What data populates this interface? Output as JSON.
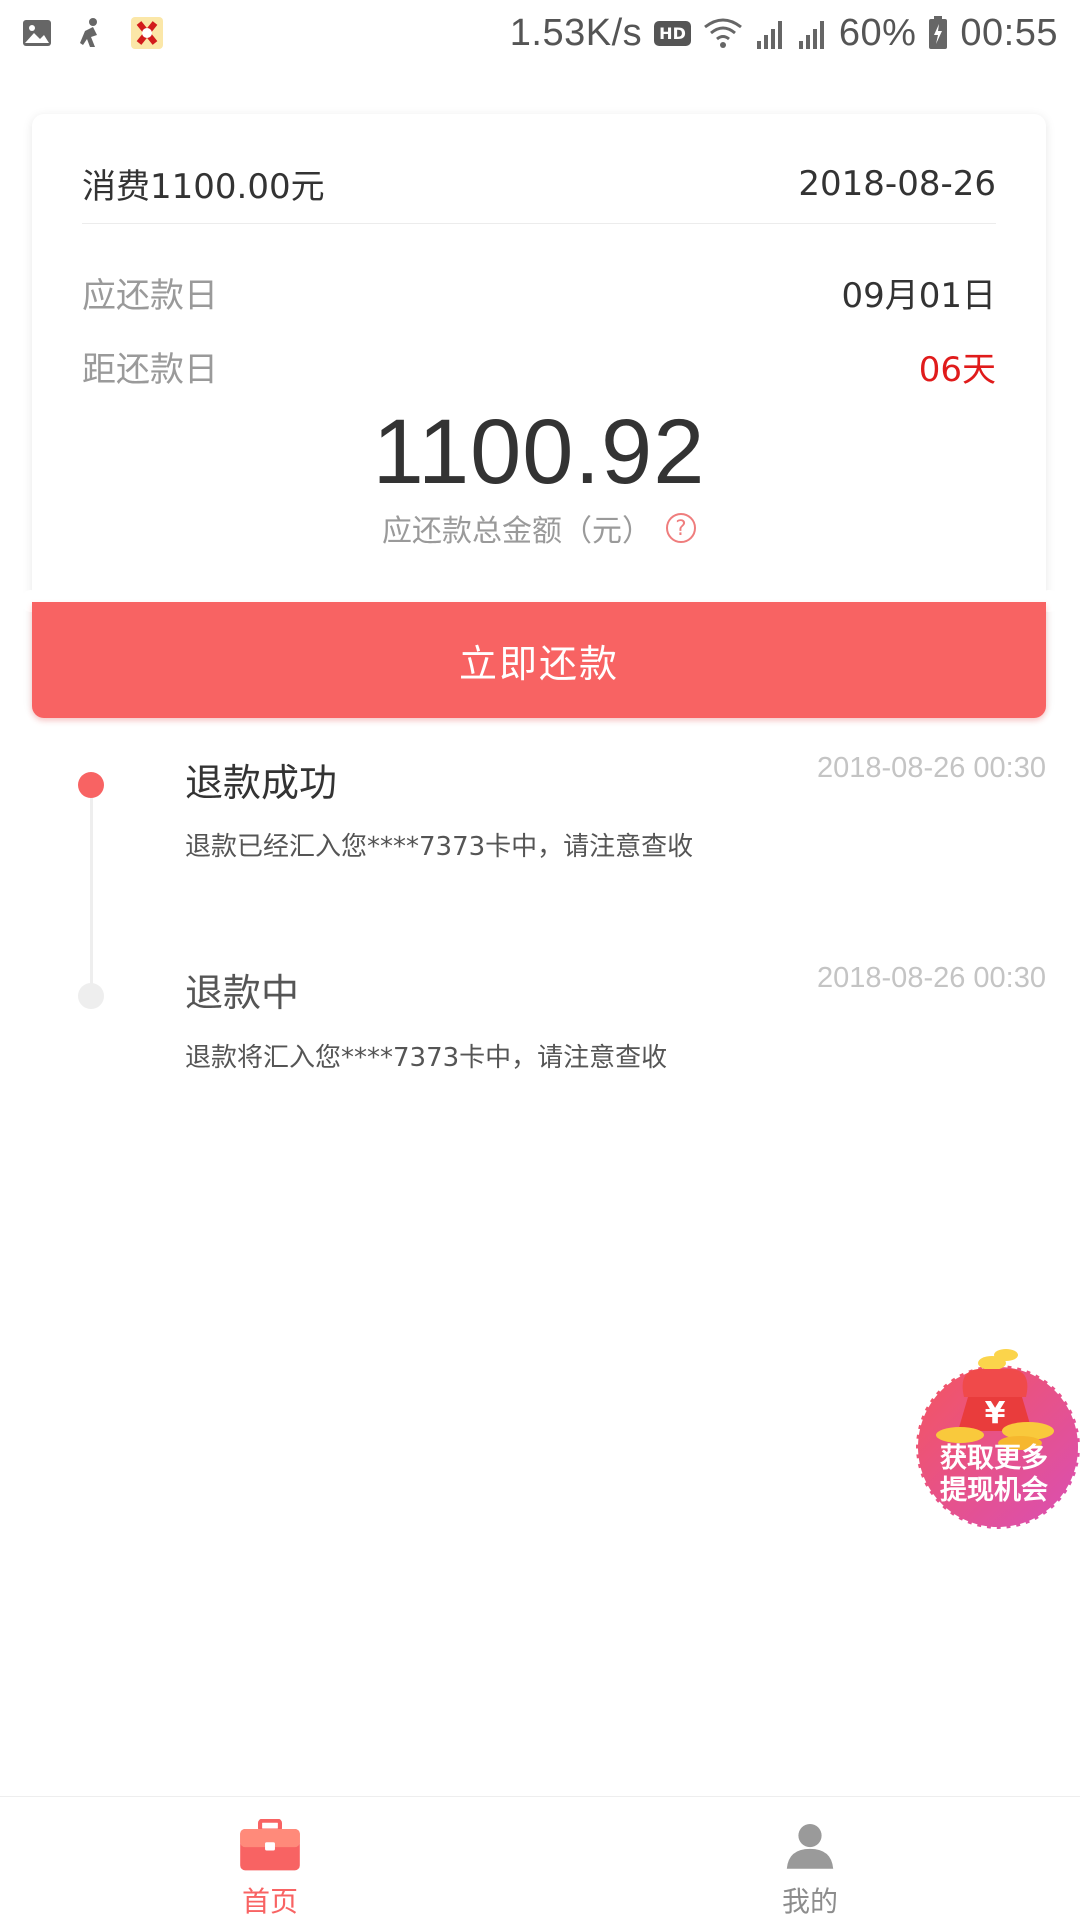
{
  "status_bar": {
    "speed": "1.53K/s",
    "hd": "HD",
    "battery": "60%",
    "time": "00:55"
  },
  "card": {
    "title": "消费1100.00元",
    "date": "2018-08-26",
    "due_label": "应还款日",
    "due_value": "09月01日",
    "days_label": "距还款日",
    "days_value": "06天",
    "amount": "1100.92",
    "amount_label": "应还款总金额（元）",
    "help": "?"
  },
  "pay_button": "立即还款",
  "timeline": [
    {
      "title": "退款成功",
      "time": "2018-08-26 00:30",
      "desc": "退款已经汇入您****7373卡中，请注意查收"
    },
    {
      "title": "退款中",
      "time": "2018-08-26 00:30",
      "desc": "退款将汇入您****7373卡中，请注意查收"
    }
  ],
  "promo": {
    "line1": "获取更多",
    "line2": "提现机会"
  },
  "bottom_nav": [
    {
      "label": "首页",
      "icon": "briefcase-icon"
    },
    {
      "label": "我的",
      "icon": "user-icon"
    }
  ],
  "colors": {
    "accent": "#f86363",
    "due_red": "#e01b1b"
  }
}
